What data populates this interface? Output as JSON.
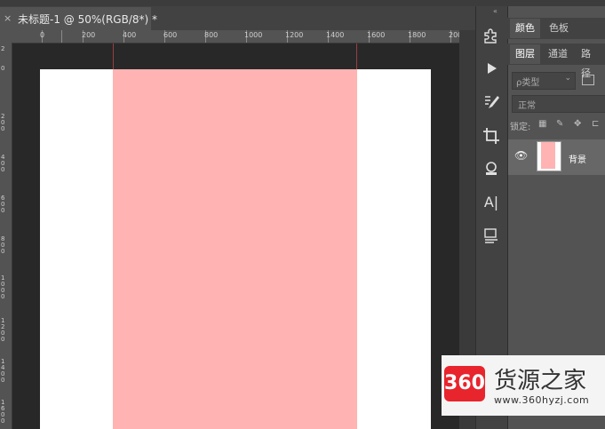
{
  "document_tab": {
    "close_glyph": "×",
    "title": "未标题-1 @ 50%(RGB/8*) *"
  },
  "ruler": {
    "top_labels": [
      "0",
      "200",
      "400",
      "600",
      "800",
      "1000",
      "1200",
      "1400",
      "1600",
      "1800",
      "200"
    ],
    "left_labels": [
      "2",
      "0",
      "2 0 0",
      "4 0 0",
      "6 0 0",
      "8 0 0",
      "1 0 0 0",
      "1 2 0 0",
      "1 4 0 0",
      "1 6 0 0"
    ]
  },
  "tools": {
    "collapse": "«",
    "items": [
      "puzzle-icon",
      "play-icon",
      "brush-settings-icon",
      "crop-icon",
      "stamp-icon",
      "character-icon",
      "paragraph-icon"
    ],
    "character_label": "A|"
  },
  "panels": {
    "color_tabs": [
      "颜色",
      "色板"
    ],
    "layer_tabs": [
      "图层",
      "通道",
      "路径"
    ],
    "filter_label": "ρ类型",
    "blend_mode": "正常",
    "lock_label": "锁定:",
    "layer_name": "背景"
  },
  "colors": {
    "rect": "#ffb3b3",
    "canvas_bg": "#282828",
    "panel_bg": "#535353"
  },
  "watermark": {
    "logo": "360",
    "name": "货源之家",
    "url": "www.360hyzj.com"
  }
}
